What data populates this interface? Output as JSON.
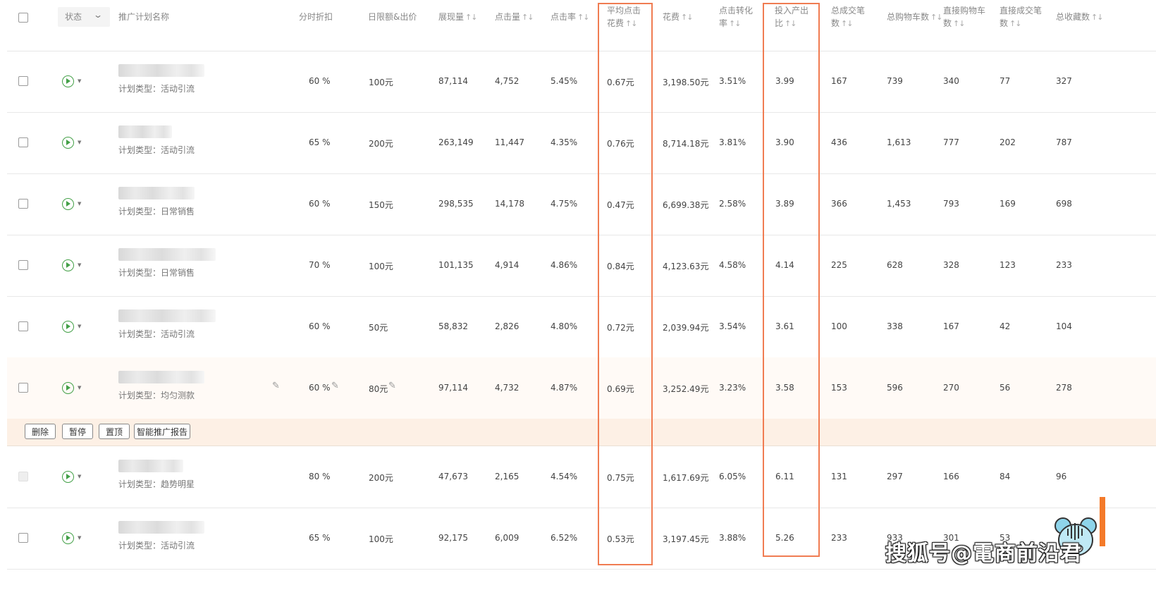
{
  "header": {
    "status_label": "状态",
    "columns": [
      {
        "key": "name",
        "line1": "推广计划名称",
        "line2": "",
        "sort": false
      },
      {
        "key": "discount",
        "line1": "分时折扣",
        "line2": "",
        "sort": false
      },
      {
        "key": "budget",
        "line1": "日限额&出价",
        "line2": "",
        "sort": false
      },
      {
        "key": "impressions",
        "line1": "展现量",
        "line2": "",
        "sort": true
      },
      {
        "key": "clicks",
        "line1": "点击量",
        "line2": "",
        "sort": true
      },
      {
        "key": "ctr",
        "line1": "点击率",
        "line2": "",
        "sort": true
      },
      {
        "key": "cpc",
        "line1": "平均点击",
        "line2": "花费",
        "sort": true
      },
      {
        "key": "cost",
        "line1": "花费",
        "line2": "",
        "sort": true
      },
      {
        "key": "cvr",
        "line1": "点击转化",
        "line2": "率",
        "sort": true
      },
      {
        "key": "roi",
        "line1": "投入产出",
        "line2": "比",
        "sort": true
      },
      {
        "key": "orders",
        "line1": "总成交笔",
        "line2": "数",
        "sort": true
      },
      {
        "key": "cart",
        "line1": "总购物车数",
        "line2": "",
        "sort": true
      },
      {
        "key": "dcart",
        "line1": "直接购物车",
        "line2": "数",
        "sort": true
      },
      {
        "key": "dorders",
        "line1": "直接成交笔",
        "line2": "数",
        "sort": true
      },
      {
        "key": "fav",
        "line1": "总收藏数",
        "line2": "",
        "sort": true
      }
    ]
  },
  "rows": [
    {
      "type": "计划类型：活动引流",
      "discount": "60 %",
      "budget": "100元",
      "impressions": "87,114",
      "clicks": "4,752",
      "ctr": "5.45%",
      "cpc": "0.67元",
      "cost": "3,198.50元",
      "cvr": "3.51%",
      "roi": "3.99",
      "orders": "167",
      "cart": "739",
      "dcart": "340",
      "dorders": "77",
      "fav": "327"
    },
    {
      "type": "计划类型：活动引流",
      "discount": "65 %",
      "budget": "200元",
      "impressions": "263,149",
      "clicks": "11,447",
      "ctr": "4.35%",
      "cpc": "0.76元",
      "cost": "8,714.18元",
      "cvr": "3.81%",
      "roi": "3.90",
      "orders": "436",
      "cart": "1,613",
      "dcart": "777",
      "dorders": "202",
      "fav": "787"
    },
    {
      "type": "计划类型：日常销售",
      "discount": "60 %",
      "budget": "150元",
      "impressions": "298,535",
      "clicks": "14,178",
      "ctr": "4.75%",
      "cpc": "0.47元",
      "cost": "6,699.38元",
      "cvr": "2.58%",
      "roi": "3.89",
      "orders": "366",
      "cart": "1,453",
      "dcart": "793",
      "dorders": "169",
      "fav": "698"
    },
    {
      "type": "计划类型：日常销售",
      "discount": "70 %",
      "budget": "100元",
      "impressions": "101,135",
      "clicks": "4,914",
      "ctr": "4.86%",
      "cpc": "0.84元",
      "cost": "4,123.63元",
      "cvr": "4.58%",
      "roi": "4.14",
      "orders": "225",
      "cart": "628",
      "dcart": "328",
      "dorders": "123",
      "fav": "233"
    },
    {
      "type": "计划类型：活动引流",
      "discount": "60 %",
      "budget": "50元",
      "impressions": "58,832",
      "clicks": "2,826",
      "ctr": "4.80%",
      "cpc": "0.72元",
      "cost": "2,039.94元",
      "cvr": "3.54%",
      "roi": "3.61",
      "orders": "100",
      "cart": "338",
      "dcart": "167",
      "dorders": "42",
      "fav": "104"
    },
    {
      "type": "计划类型：均匀测款",
      "discount": "60 %",
      "budget": "80元",
      "impressions": "97,114",
      "clicks": "4,732",
      "ctr": "4.87%",
      "cpc": "0.69元",
      "cost": "3,252.49元",
      "cvr": "3.23%",
      "roi": "3.58",
      "orders": "153",
      "cart": "596",
      "dcart": "270",
      "dorders": "56",
      "fav": "278"
    },
    {
      "type": "计划类型：趋势明星",
      "discount": "80 %",
      "budget": "200元",
      "impressions": "47,673",
      "clicks": "2,165",
      "ctr": "4.54%",
      "cpc": "0.75元",
      "cost": "1,617.69元",
      "cvr": "6.05%",
      "roi": "6.11",
      "orders": "131",
      "cart": "297",
      "dcart": "166",
      "dorders": "84",
      "fav": "96"
    },
    {
      "type": "计划类型：活动引流",
      "discount": "65 %",
      "budget": "100元",
      "impressions": "92,175",
      "clicks": "6,009",
      "ctr": "6.52%",
      "cpc": "0.53元",
      "cost": "3,197.45元",
      "cvr": "3.88%",
      "roi": "5.26",
      "orders": "233",
      "cart": "933",
      "dcart": "301",
      "dorders": "53",
      "fav": ""
    }
  ],
  "actions": {
    "delete": "删除",
    "pause": "暂停",
    "pin": "置顶",
    "report": "智能推广报告"
  },
  "watermark": "搜狐号@電商前沿君",
  "colors": {
    "highlight_box": "#f07c52",
    "status_green": "#43a047",
    "action_bar": "#fdf0e5",
    "hover_row": "#fffaf6"
  }
}
